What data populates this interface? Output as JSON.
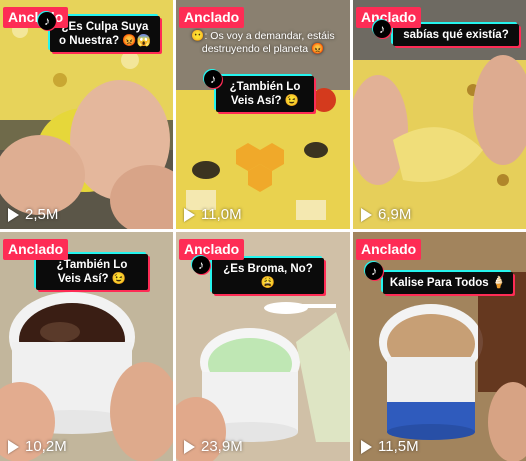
{
  "pinned_label": "Anclado",
  "videos": [
    {
      "caption_line1": "¿Es Culpa Suya",
      "caption_line2": "o Nuestra? 😡😱",
      "views": "2,5M"
    },
    {
      "top_text": "😶: Os voy a demandar, estáis destruyendo el planeta 😡",
      "caption_line1": "¿También Lo",
      "caption_line2": "Veis Así? 😉",
      "views": "11,0M"
    },
    {
      "caption_line1": "sabías qué existía?",
      "views": "6,9M"
    },
    {
      "caption_line1": "¿También Lo",
      "caption_line2": "Veis Así? 😉",
      "views": "10,2M"
    },
    {
      "caption_line1": "¿Es Broma, No? 😩",
      "views": "23,9M"
    },
    {
      "caption_line1": "Kalise Para Todos 🍦",
      "views": "11,5M"
    }
  ],
  "colors": {
    "pinned_bg": "#fe2c55",
    "caption_bg": "#0b0b0b",
    "accent_cyan": "#25f4ee"
  },
  "icons": {
    "views": "play-icon",
    "logo": "tiktok-logo-icon"
  }
}
